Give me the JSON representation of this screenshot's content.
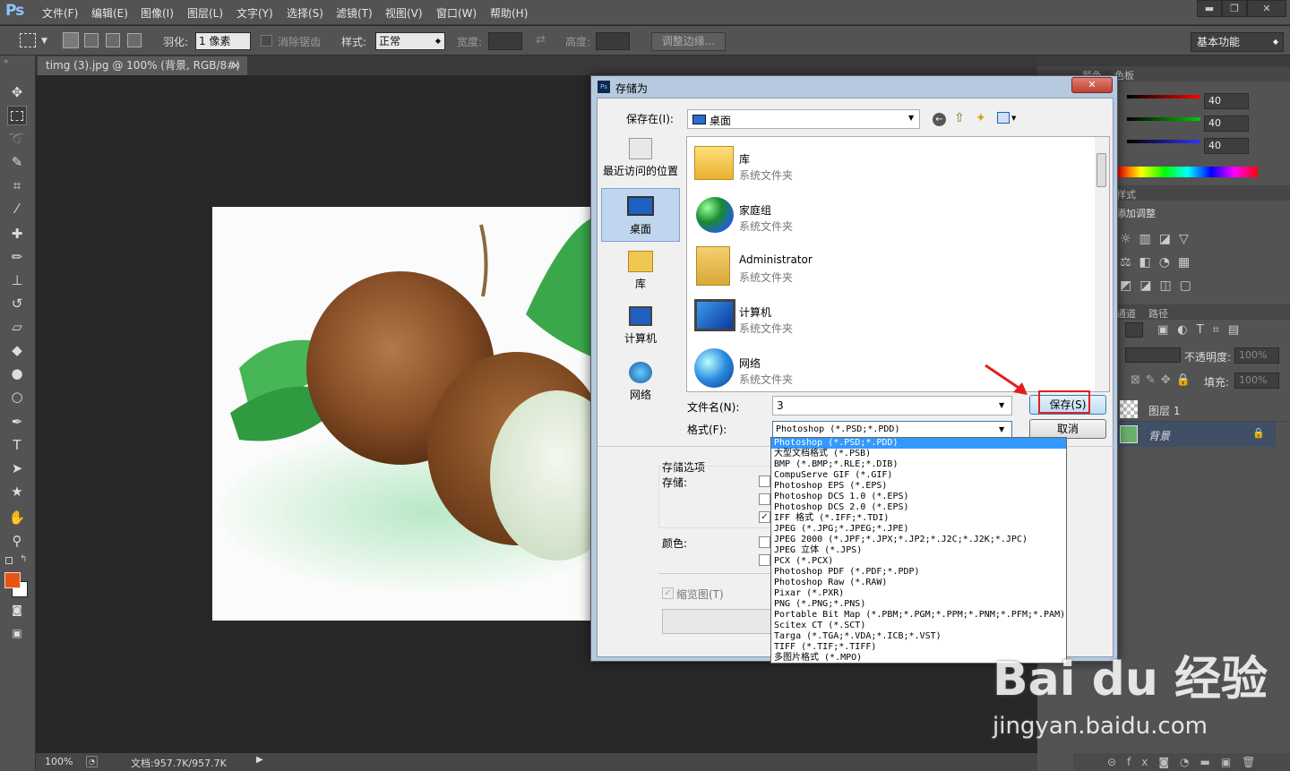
{
  "app": {
    "logo": "Ps"
  },
  "menubar": {
    "items": [
      "文件(F)",
      "编辑(E)",
      "图像(I)",
      "图层(L)",
      "文字(Y)",
      "选择(S)",
      "滤镜(T)",
      "视图(V)",
      "窗口(W)",
      "帮助(H)"
    ]
  },
  "window_controls": {
    "minimize": "▬",
    "restore": "❐",
    "close": "✕"
  },
  "options": {
    "feather_label": "羽化:",
    "feather_value": "1 像素",
    "antialias_label": "消除锯齿",
    "style_label": "样式:",
    "style_value": "正常",
    "width_label": "宽度:",
    "height_label": "高度:",
    "refine_button": "调整边缘...",
    "workspace": "基本功能"
  },
  "document": {
    "tab_title": "timg (3).jpg @ 100% (背景, RGB/8#) *",
    "tab_close": "×"
  },
  "status": {
    "zoom": "100%",
    "doc_info": "文档:957.7K/957.7K"
  },
  "panels": {
    "color_tabs": [
      "颜色",
      "色板"
    ],
    "rgb_values": [
      "40",
      "40",
      "40"
    ],
    "adjust_tab": "样式",
    "adjust_label": "添加调整",
    "layers_tabs": [
      "通道",
      "路径"
    ],
    "opacity_label": "不透明度:",
    "opacity_value": "100%",
    "fill_label": "填充:",
    "fill_value": "100%",
    "layers": [
      {
        "name": "图层 1"
      },
      {
        "name": "背景",
        "locked": true
      }
    ]
  },
  "dialog": {
    "title": "存储为",
    "save_in_label": "保存在(I):",
    "save_in_value": "桌面",
    "places": [
      "最近访问的位置",
      "桌面",
      "库",
      "计算机",
      "网络"
    ],
    "files": [
      {
        "name": "库",
        "type": "系统文件夹",
        "icon": "library-icon"
      },
      {
        "name": "家庭组",
        "type": "系统文件夹",
        "icon": "homegroup-icon"
      },
      {
        "name": "Administrator",
        "type": "系统文件夹",
        "icon": "user-folder-icon"
      },
      {
        "name": "计算机",
        "type": "系统文件夹",
        "icon": "computer-icon"
      },
      {
        "name": "网络",
        "type": "系统文件夹",
        "icon": "network-icon"
      }
    ],
    "filename_label": "文件名(N):",
    "filename_value": "3",
    "format_label": "格式(F):",
    "format_value": "Photoshop (*.PSD;*.PDD)",
    "save_button": "保存(S)",
    "cancel_button": "取消",
    "save_options_label": "存储选项",
    "store_label": "存储:",
    "color_label": "颜色:",
    "thumbnail_label": "缩览图(T)",
    "format_options": [
      "Photoshop (*.PSD;*.PDD)",
      "大型文档格式 (*.PSB)",
      "BMP (*.BMP;*.RLE;*.DIB)",
      "CompuServe GIF (*.GIF)",
      "Photoshop EPS (*.EPS)",
      "Photoshop DCS 1.0 (*.EPS)",
      "Photoshop DCS 2.0 (*.EPS)",
      "IFF 格式 (*.IFF;*.TDI)",
      "JPEG (*.JPG;*.JPEG;*.JPE)",
      "JPEG 2000 (*.JPF;*.JPX;*.JP2;*.J2C;*.J2K;*.JPC)",
      "JPEG 立体 (*.JPS)",
      "PCX (*.PCX)",
      "Photoshop PDF (*.PDF;*.PDP)",
      "Photoshop Raw (*.RAW)",
      "Pixar (*.PXR)",
      "PNG (*.PNG;*.PNS)",
      "Portable Bit Map (*.PBM;*.PGM;*.PPM;*.PNM;*.PFM;*.PAM)",
      "Scitex CT (*.SCT)",
      "Targa (*.TGA;*.VDA;*.ICB;*.VST)",
      "TIFF (*.TIF;*.TIFF)",
      "多图片格式 (*.MPO)"
    ]
  },
  "watermark": {
    "brand": "Bai du 经验",
    "url": "jingyan.baidu.com"
  },
  "colors": {
    "accent_red": "#e02020",
    "selection_blue": "#3399ff",
    "fg_swatch": "#e8540e"
  }
}
